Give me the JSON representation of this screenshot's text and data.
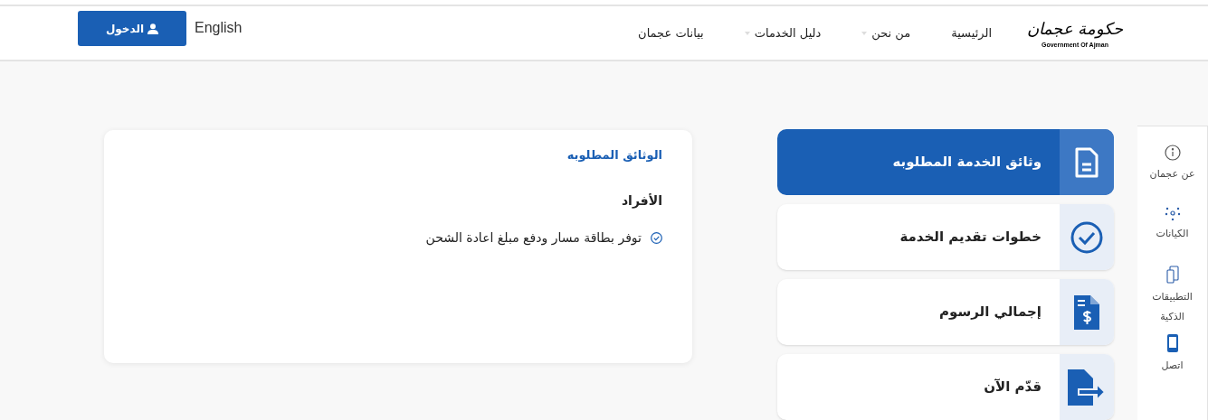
{
  "header": {
    "logo": {
      "calligraphy": "حكومة عجمان",
      "caption": "Government Of Ajman"
    },
    "nav": [
      {
        "label": "الرئيسية",
        "dropdown": false
      },
      {
        "label": "من نحن",
        "dropdown": true
      },
      {
        "label": "دليل الخدمات",
        "dropdown": true
      },
      {
        "label": "بيانات عجمان",
        "dropdown": false
      }
    ],
    "language": "English",
    "login_button": "الدخول"
  },
  "side_rail": [
    {
      "label": "عن عجمان",
      "kind": "info"
    },
    {
      "label": "الكيانات",
      "kind": "network"
    },
    {
      "label": "التطبيقات الذكية",
      "kind": "apps"
    },
    {
      "label": "اتصل",
      "kind": "phone"
    }
  ],
  "service_tabs": [
    {
      "label": "وثائق الخدمة المطلوبه",
      "kind": "document",
      "selected": true
    },
    {
      "label": "خطوات تقديم الخدمة",
      "kind": "check",
      "selected": false
    },
    {
      "label": "إجمالي الرسوم",
      "kind": "fees",
      "selected": false
    },
    {
      "label": "قدّم الآن",
      "kind": "submit",
      "selected": false
    }
  ],
  "content_card": {
    "title": "الوثائق المطلوبه",
    "section": "الأفراد",
    "items": [
      "توفر بطاقة مسار ودفع مبلغ اعادة الشحن"
    ]
  }
}
